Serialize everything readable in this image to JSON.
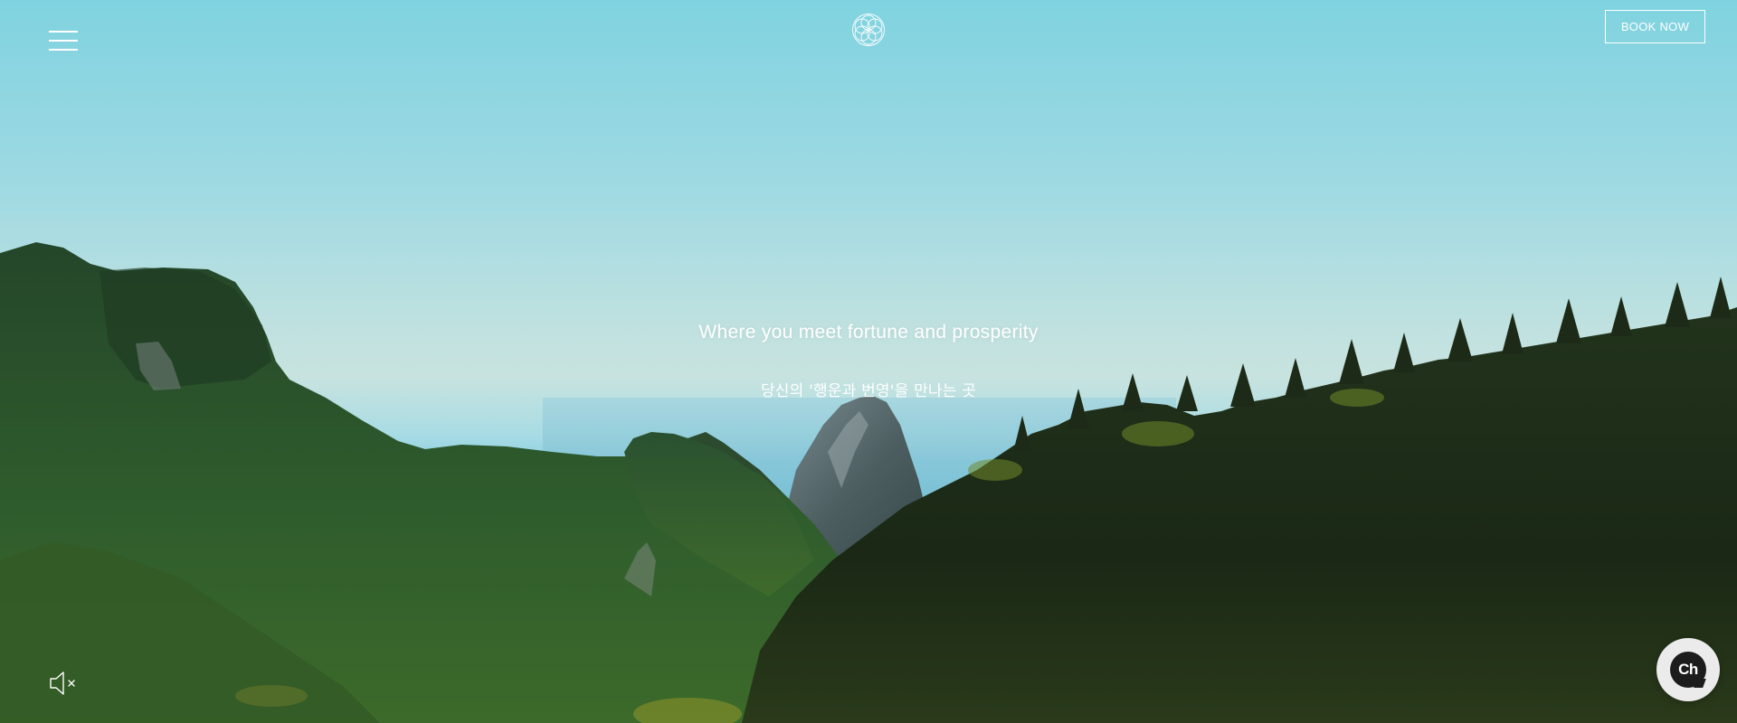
{
  "header": {
    "menu_icon": "hamburger-menu-icon",
    "logo_icon": "flower-of-life-logo",
    "book_label": "BOOK NOW"
  },
  "hero": {
    "headline": "Where you meet fortune and prosperity",
    "subheadline": "당신의 '행운과 번영'을 만나는 곳",
    "mute_icon": "speaker-muted-icon"
  },
  "chat": {
    "label": "Ch",
    "icon": "chat-bubble-icon"
  },
  "colors": {
    "sky_top": "#7fd3e0",
    "sky_haze": "#c8e3df",
    "forest_dark": "#1f3a22",
    "forest_mid": "#2f5a2e",
    "text": "#ffffff",
    "chat_bg": "#ebebeb",
    "chat_fg": "#1c1c1c"
  }
}
